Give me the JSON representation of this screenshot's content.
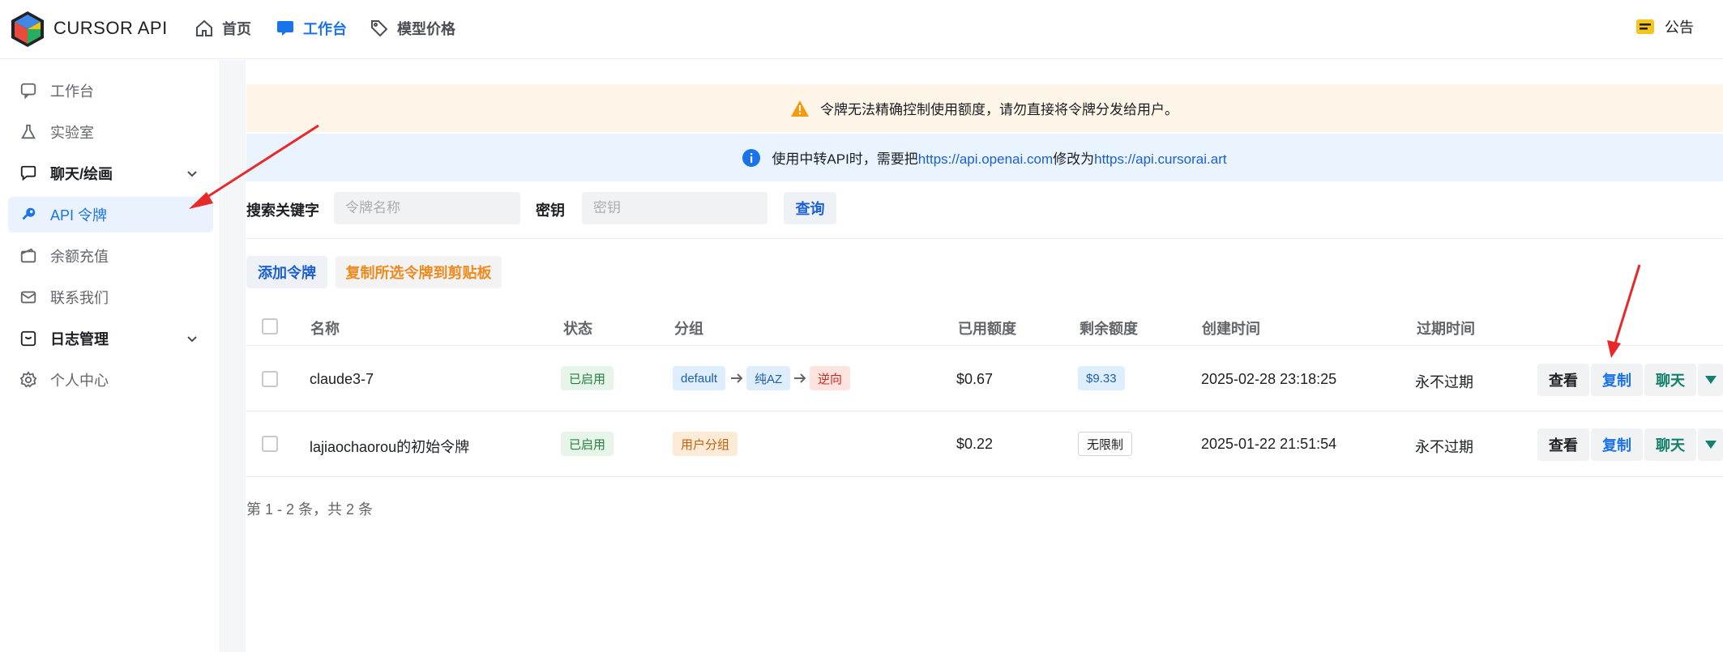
{
  "header": {
    "brand": "CURSOR API",
    "nav": [
      {
        "label": "首页",
        "icon": "home-icon"
      },
      {
        "label": "工作台",
        "icon": "workbench-icon"
      },
      {
        "label": "模型价格",
        "icon": "price-tag-icon"
      }
    ],
    "notice_label": "公告"
  },
  "sidebar": {
    "items": [
      {
        "label": "工作台",
        "icon": "chat-bubble-icon"
      },
      {
        "label": "实验室",
        "icon": "flask-icon"
      },
      {
        "label": "聊天/绘画",
        "icon": "chat-icon"
      },
      {
        "label": "API 令牌",
        "icon": "key-icon"
      },
      {
        "label": "余额充值",
        "icon": "wallet-icon"
      },
      {
        "label": "联系我们",
        "icon": "mail-icon"
      },
      {
        "label": "日志管理",
        "icon": "log-icon"
      },
      {
        "label": "个人中心",
        "icon": "settings-icon"
      }
    ]
  },
  "banners": {
    "warning": "令牌无法精确控制使用额度，请勿直接将令牌分发给用户。",
    "info_prefix": "使用中转API时，需要把",
    "info_link1": "https://api.openai.com",
    "info_middle": "修改为",
    "info_link2": "https://api.cursorai.art"
  },
  "search": {
    "keyword_label": "搜索关键字",
    "keyword_placeholder": "令牌名称",
    "key_label": "密钥",
    "key_placeholder": "密钥",
    "query_button": "查询"
  },
  "toolbar": {
    "add_button": "添加令牌",
    "copy_selected_button": "复制所选令牌到剪贴板"
  },
  "table": {
    "headers": [
      "名称",
      "状态",
      "分组",
      "已用额度",
      "剩余额度",
      "创建时间",
      "过期时间"
    ],
    "rows": [
      {
        "name": "claude3-7",
        "status": "已启用",
        "groups": [
          "default",
          "纯AZ",
          "逆向"
        ],
        "used": "$0.67",
        "remaining": "$9.33",
        "created": "2025-02-28 23:18:25",
        "expires": "永不过期"
      },
      {
        "name": "lajiaochaorou的初始令牌",
        "status": "已启用",
        "groups": [
          "用户分组"
        ],
        "used": "$0.22",
        "remaining": "无限制",
        "created": "2025-01-22 21:51:54",
        "expires": "永不过期"
      }
    ],
    "actions": {
      "view": "查看",
      "copy": "复制",
      "chat": "聊天"
    }
  },
  "pagination_text": "第 1 - 2 条，共 2 条",
  "colors": {
    "accent": "#1a73e8",
    "annotation_arrow": "#e8292a"
  }
}
